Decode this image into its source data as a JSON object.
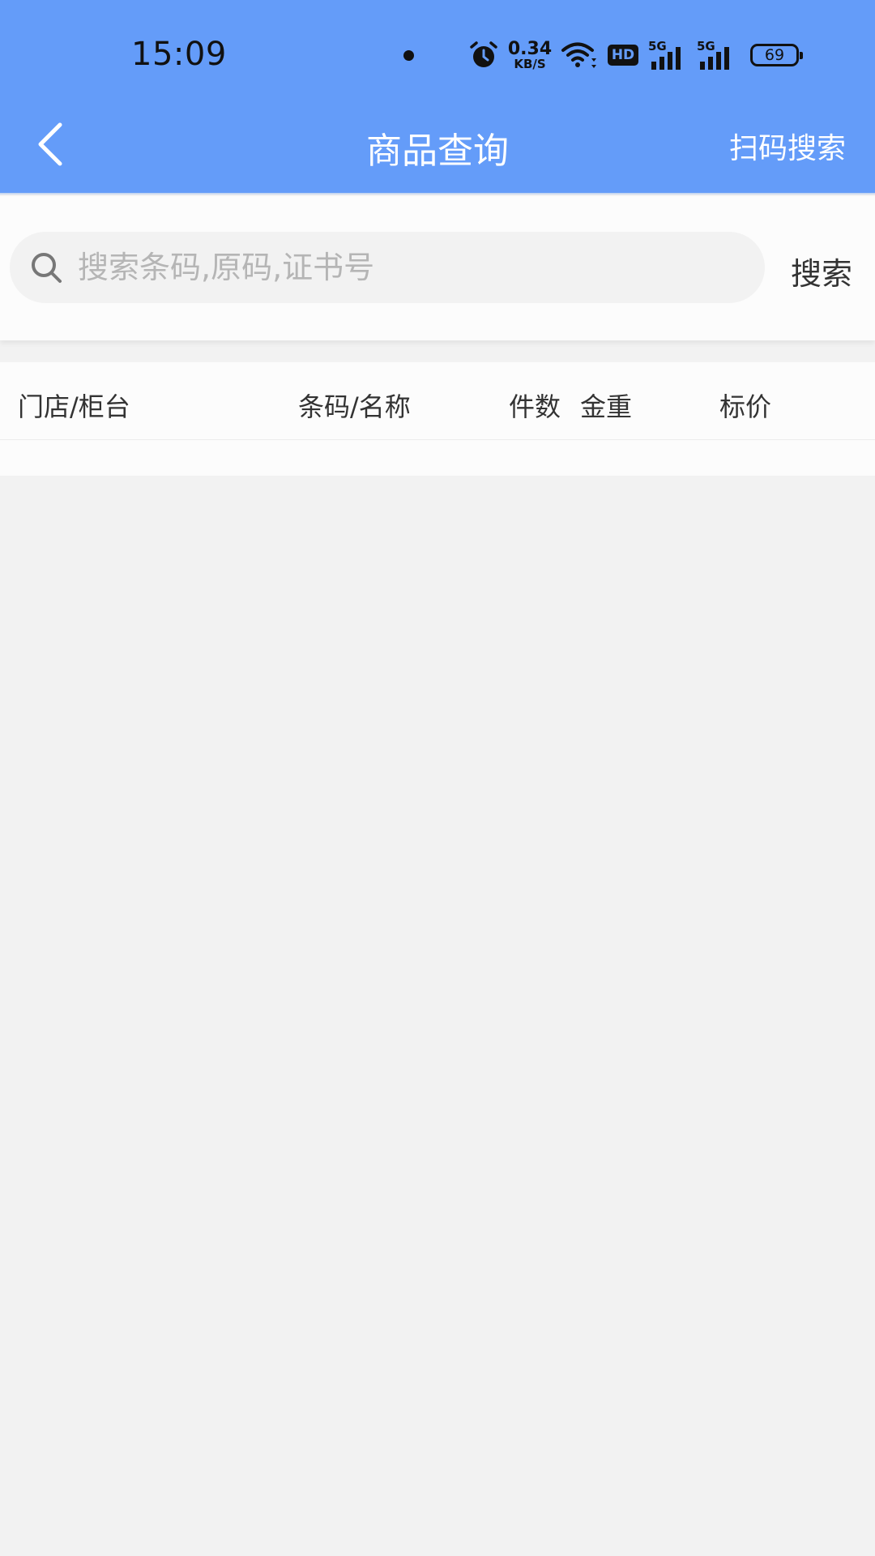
{
  "status_bar": {
    "time": "15:09",
    "net_speed_value": "0.34",
    "net_speed_unit": "KB/S",
    "hd_label": "HD",
    "signal_1_label": "5G",
    "signal_2_label": "5G",
    "battery_level": "69",
    "icons": [
      "alarm-icon",
      "wifi-icon",
      "hd-badge",
      "signal-5g-icon",
      "signal-5g-icon",
      "battery-icon"
    ]
  },
  "nav": {
    "title": "商品查询",
    "right_action": "扫码搜索",
    "back_icon": "chevron-left-icon"
  },
  "search": {
    "placeholder": "搜索条码,原码,证书号",
    "value": "",
    "button_label": "搜索"
  },
  "table": {
    "columns": [
      "门店/柜台",
      "条码/名称",
      "件数",
      "金重",
      "标价"
    ],
    "rows": []
  },
  "colors": {
    "header_bg": "#649cf9",
    "page_bg": "#f2f2f2",
    "panel_bg": "#fcfcfc"
  }
}
